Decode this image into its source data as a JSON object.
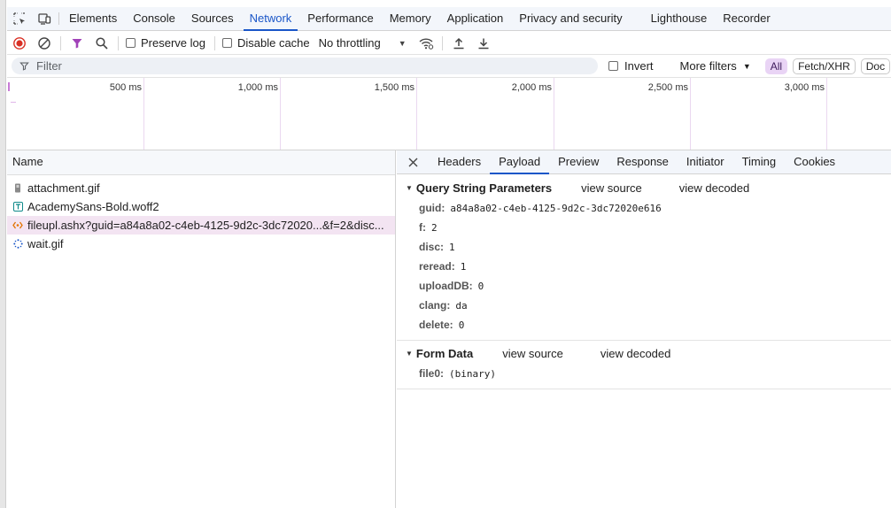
{
  "tabs": [
    "Elements",
    "Console",
    "Sources",
    "Network",
    "Performance",
    "Memory",
    "Application",
    "Privacy and security",
    "Lighthouse",
    "Recorder"
  ],
  "active_tab": "Network",
  "toolbar": {
    "preserve_log": "Preserve log",
    "disable_cache": "Disable cache",
    "throttling": "No throttling"
  },
  "filter": {
    "placeholder": "Filter",
    "invert": "Invert",
    "more_filters": "More filters",
    "chips": [
      "All",
      "Fetch/XHR",
      "Doc"
    ]
  },
  "overview": {
    "ticks": [
      "500 ms",
      "1,000 ms",
      "1,500 ms",
      "2,000 ms",
      "2,500 ms",
      "3,000 ms"
    ]
  },
  "requests": {
    "header": "Name",
    "rows": [
      {
        "name": "attachment.gif",
        "icon": "image-icon"
      },
      {
        "name": "AcademySans-Bold.woff2",
        "icon": "font-icon"
      },
      {
        "name": "fileupl.ashx?guid=a84a8a02-c4eb-4125-9d2c-3dc72020...&f=2&disc...",
        "icon": "xhr-icon"
      },
      {
        "name": "wait.gif",
        "icon": "loading-icon"
      }
    ]
  },
  "details": {
    "tabs": [
      "Headers",
      "Payload",
      "Preview",
      "Response",
      "Initiator",
      "Timing",
      "Cookies"
    ],
    "active": "Payload",
    "query": {
      "title": "Query String Parameters",
      "view_source": "view source",
      "view_decoded": "view decoded",
      "params": [
        {
          "k": "guid:",
          "v": "a84a8a02-c4eb-4125-9d2c-3dc72020e616"
        },
        {
          "k": "f:",
          "v": "2"
        },
        {
          "k": "disc:",
          "v": "1"
        },
        {
          "k": "reread:",
          "v": "1"
        },
        {
          "k": "uploadDB:",
          "v": "0"
        },
        {
          "k": "clang:",
          "v": "da"
        },
        {
          "k": "delete:",
          "v": "0"
        }
      ]
    },
    "form": {
      "title": "Form Data",
      "view_source": "view source",
      "view_decoded": "view decoded",
      "params": [
        {
          "k": "file0:",
          "v": "(binary)"
        }
      ]
    }
  },
  "colors": {
    "accent": "#1a56c8",
    "record": "#d93025",
    "selected_row": "#f3e4f2",
    "all_chip": "#e9d4f5"
  }
}
